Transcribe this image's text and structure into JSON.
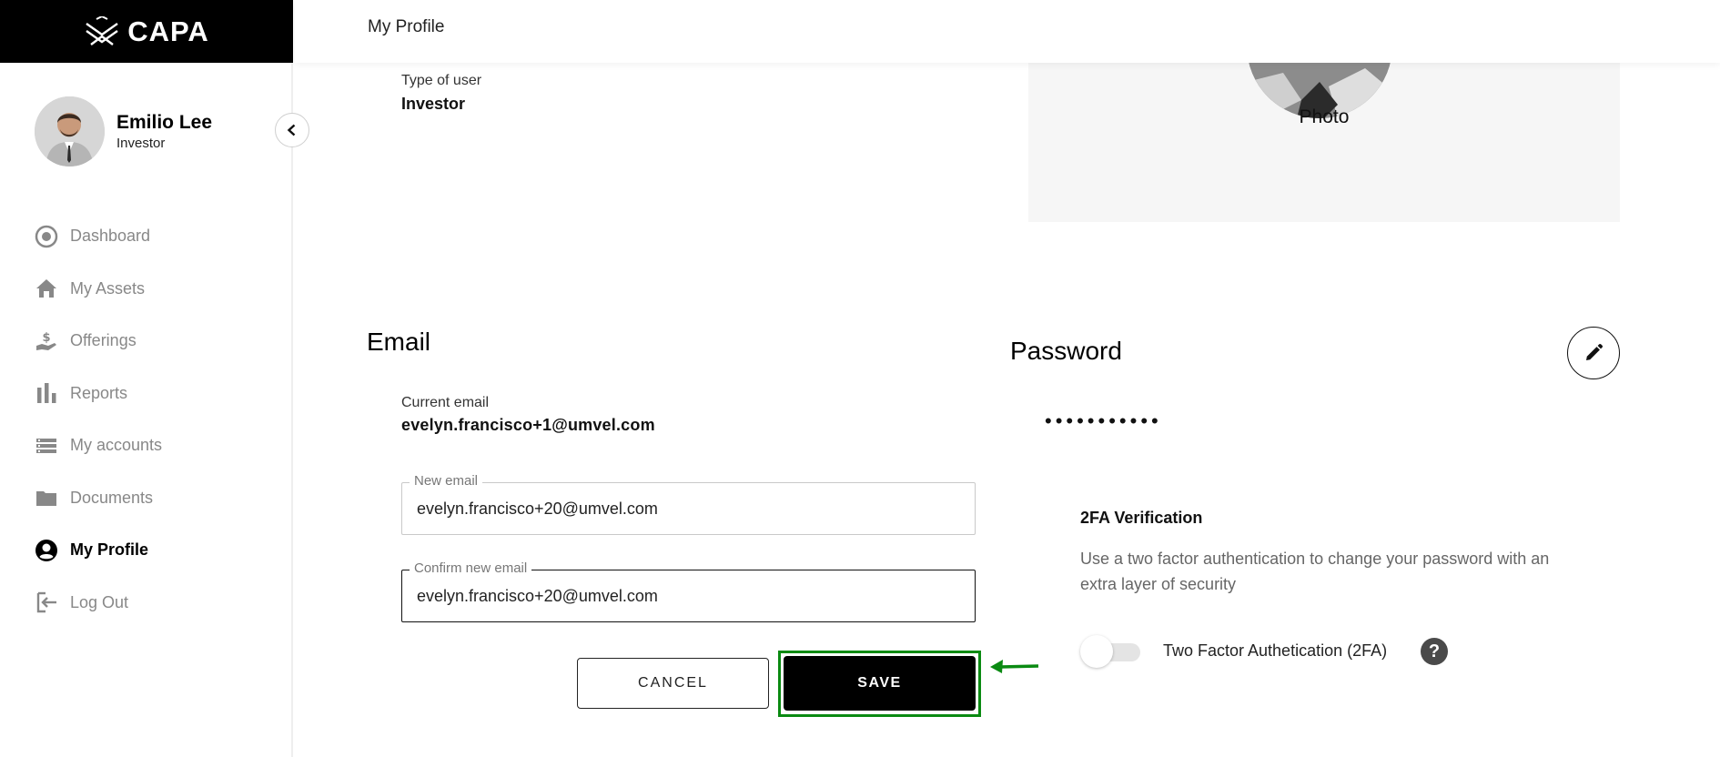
{
  "brand": {
    "name": "CAPA"
  },
  "header": {
    "title": "My Profile"
  },
  "user": {
    "name": "Emilio Lee",
    "role": "Investor"
  },
  "sidebar": {
    "items": [
      {
        "label": "Dashboard",
        "icon": "dashboard-icon",
        "active": false
      },
      {
        "label": "My Assets",
        "icon": "home-icon",
        "active": false
      },
      {
        "label": "Offerings",
        "icon": "hand-dollar-icon",
        "active": false
      },
      {
        "label": "Reports",
        "icon": "bar-chart-icon",
        "active": false
      },
      {
        "label": "My accounts",
        "icon": "list-icon",
        "active": false
      },
      {
        "label": "Documents",
        "icon": "folder-icon",
        "active": false
      },
      {
        "label": "My Profile",
        "icon": "account-circle-icon",
        "active": true
      },
      {
        "label": "Log Out",
        "icon": "logout-icon",
        "active": false
      }
    ]
  },
  "profile": {
    "type_label": "Type of user",
    "type_value": "Investor",
    "photo_label": "Photo"
  },
  "email": {
    "heading": "Email",
    "current_label": "Current email",
    "current_value": "evelyn.francisco+1@umvel.com",
    "new_label": "New email",
    "new_value": "evelyn.francisco+20@umvel.com",
    "confirm_label": "Confirm new email",
    "confirm_value": "evelyn.francisco+20@umvel.com",
    "cancel_label": "CANCEL",
    "save_label": "SAVE"
  },
  "password": {
    "heading": "Password",
    "masked": "•••••••••••"
  },
  "tfa": {
    "heading": "2FA Verification",
    "description": "Use a two factor authentication to change your password with an extra layer of security",
    "toggle_label": "Two Factor Authetication (2FA)",
    "enabled": false,
    "help_symbol": "?"
  },
  "colors": {
    "highlight": "#0a8a12",
    "primary": "#000000",
    "muted": "#888888"
  }
}
